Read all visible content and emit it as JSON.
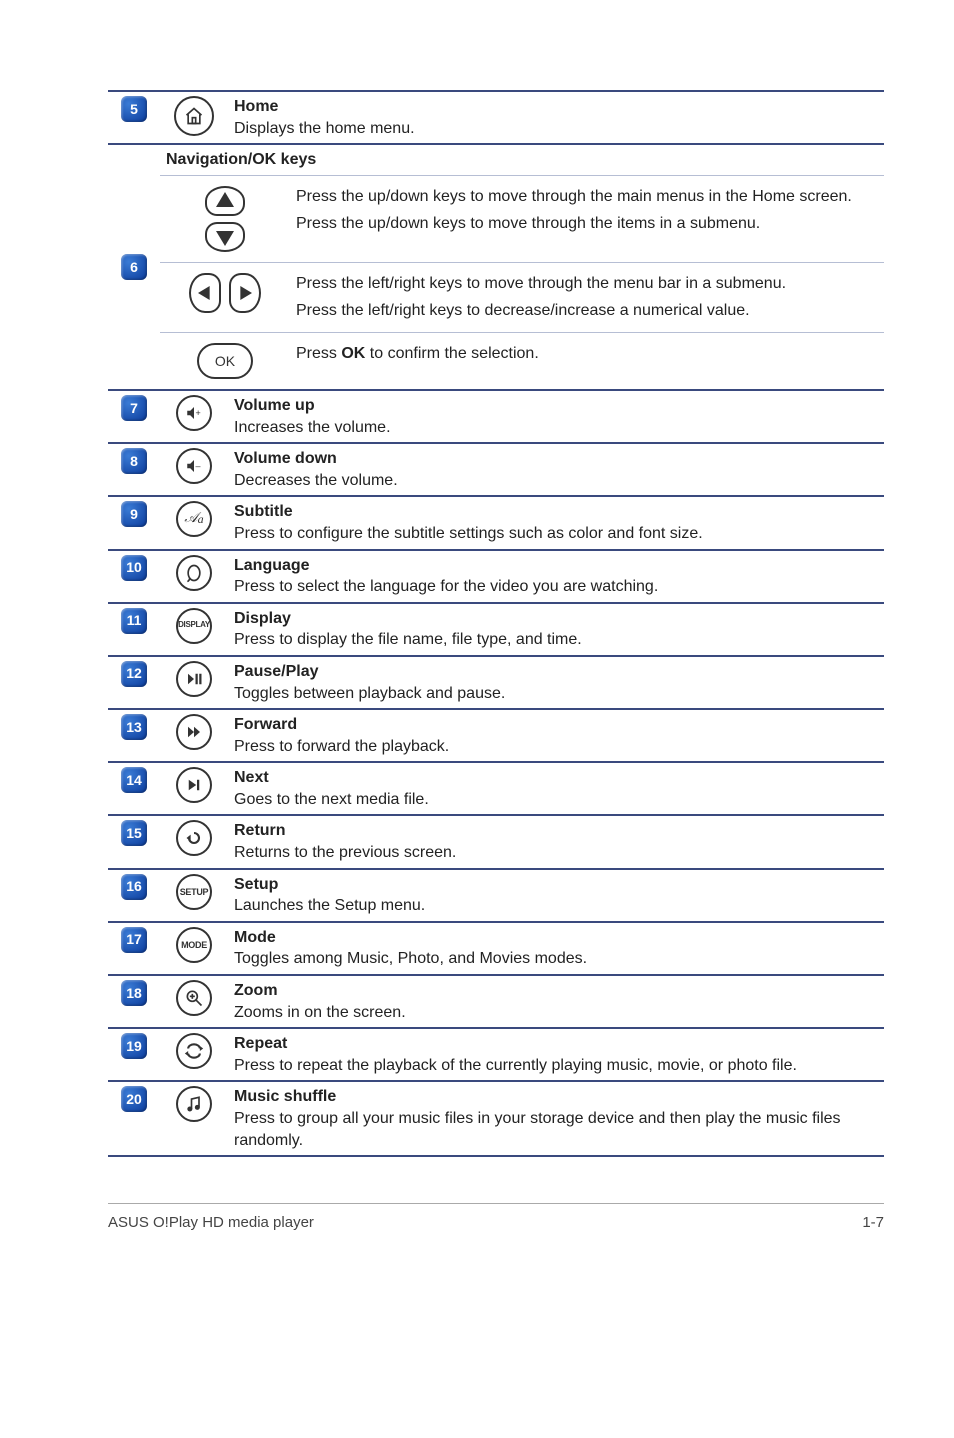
{
  "rows": {
    "r5": {
      "num": "5",
      "title": "Home",
      "desc": "Displays the home menu."
    },
    "r6": {
      "num": "6",
      "heading": "Navigation/OK keys",
      "updown1": "Press the up/down keys to move through the main menus in the Home screen.",
      "updown2": "Press the up/down keys to move through the items in a submenu.",
      "leftright1": "Press the left/right keys to move through the menu bar in a submenu.",
      "leftright2": "Press the left/right keys to decrease/increase a numerical value.",
      "ok_label": "OK",
      "ok_desc_pre": "Press ",
      "ok_desc_strong": "OK",
      "ok_desc_post": " to confirm the selection."
    },
    "r7": {
      "num": "7",
      "title": "Volume up",
      "desc": "Increases the volume."
    },
    "r8": {
      "num": "8",
      "title": "Volume down",
      "desc": "Decreases the volume."
    },
    "r9": {
      "num": "9",
      "title": "Subtitle",
      "desc": "Press to configure the subtitle settings such as color and font size."
    },
    "r10": {
      "num": "10",
      "title": "Language",
      "desc": "Press to select the language for the video you are watching."
    },
    "r11": {
      "num": "11",
      "icon_label": "DISPLAY",
      "title": "Display",
      "desc": "Press to display the file name, file type, and time."
    },
    "r12": {
      "num": "12",
      "title": "Pause/Play",
      "desc": "Toggles between playback and pause."
    },
    "r13": {
      "num": "13",
      "title": "Forward",
      "desc": "Press to forward the playback."
    },
    "r14": {
      "num": "14",
      "title": "Next",
      "desc": "Goes to the next media file."
    },
    "r15": {
      "num": "15",
      "title": "Return",
      "desc": "Returns to the previous screen."
    },
    "r16": {
      "num": "16",
      "icon_label": "SETUP",
      "title": "Setup",
      "desc": "Launches the Setup menu."
    },
    "r17": {
      "num": "17",
      "icon_label": "MODE",
      "title": "Mode",
      "desc": "Toggles among Music, Photo, and Movies modes."
    },
    "r18": {
      "num": "18",
      "title": "Zoom",
      "desc": "Zooms in on the screen."
    },
    "r19": {
      "num": "19",
      "title": "Repeat",
      "desc": "Press to repeat the playback of the currently playing music, movie, or photo file."
    },
    "r20": {
      "num": "20",
      "title": "Music shuffle",
      "desc": "Press to group all your music files in your storage device and then play the music files randomly."
    }
  },
  "footer": {
    "left": "ASUS O!Play HD media player",
    "right": "1-7"
  }
}
